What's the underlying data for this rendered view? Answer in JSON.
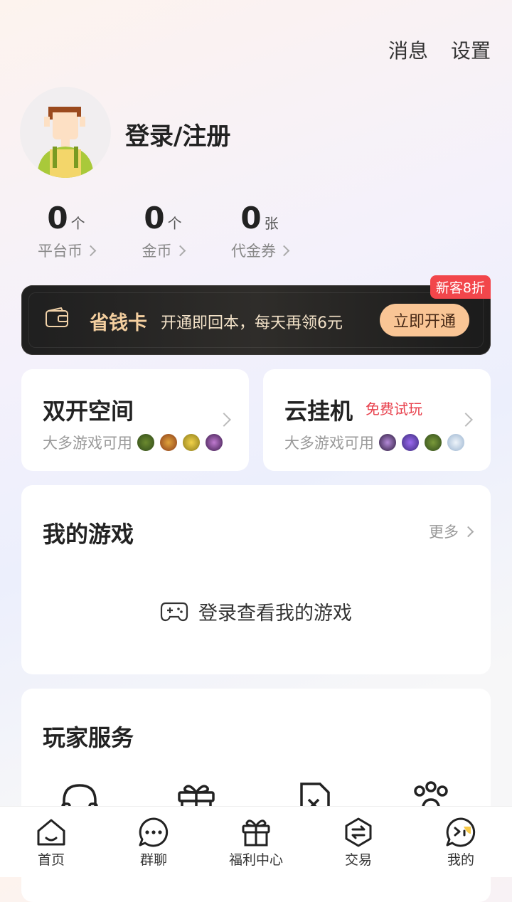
{
  "header": {
    "messages_label": "消息",
    "settings_label": "设置"
  },
  "profile": {
    "login_label": "登录/注册"
  },
  "stats": [
    {
      "value": "0",
      "unit": "个",
      "label": "平台币"
    },
    {
      "value": "0",
      "unit": "个",
      "label": "金币"
    },
    {
      "value": "0",
      "unit": "张",
      "label": "代金券"
    }
  ],
  "savecard": {
    "badge": "新客8折",
    "title": "省钱卡",
    "desc": "开通即回本，每天再领6元",
    "button": "立即开通"
  },
  "features": [
    {
      "title": "双开空间",
      "subtitle": "大多游戏可用"
    },
    {
      "title": "云挂机",
      "tag": "免费试玩",
      "subtitle": "大多游戏可用"
    }
  ],
  "mygames": {
    "title": "我的游戏",
    "more": "更多",
    "empty": "登录查看我的游戏"
  },
  "services": {
    "title": "玩家服务"
  },
  "tabbar": {
    "items": [
      {
        "label": "首页",
        "icon": "home-icon"
      },
      {
        "label": "群聊",
        "icon": "chat-icon"
      },
      {
        "label": "福利中心",
        "icon": "gift-icon"
      },
      {
        "label": "交易",
        "icon": "trade-icon"
      },
      {
        "label": "我的",
        "icon": "profile-icon"
      }
    ]
  }
}
